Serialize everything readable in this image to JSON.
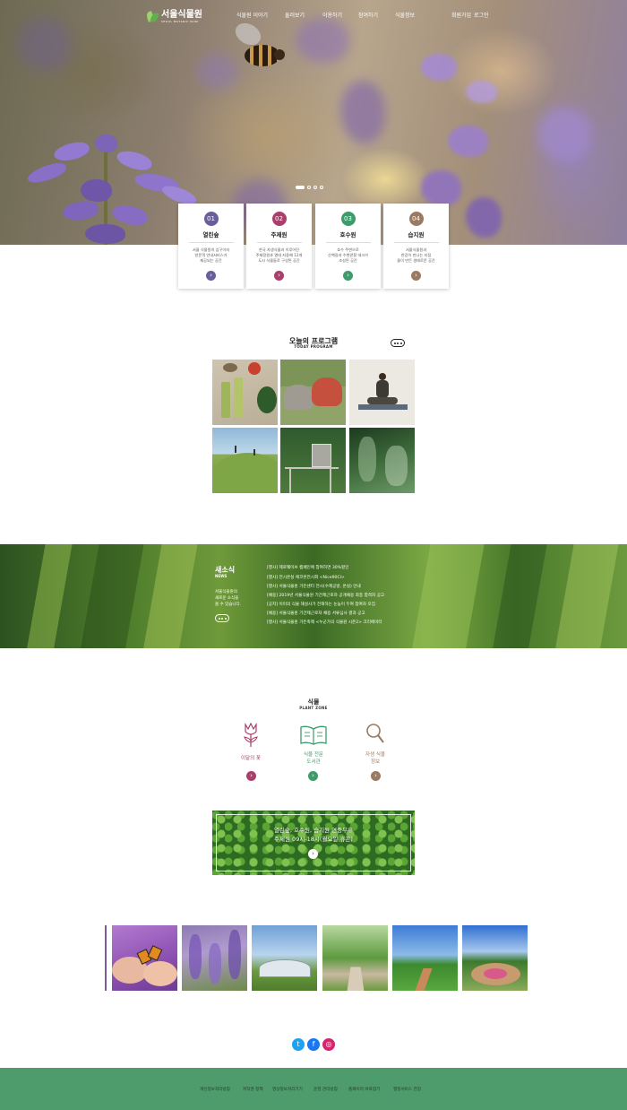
{
  "brand": {
    "name": "서울식물원",
    "sub": "SEOUL BOTANIC PARK"
  },
  "nav": {
    "items": [
      "식물원 이야기",
      "둘러보기",
      "이용하기",
      "참여하기",
      "식물정보"
    ]
  },
  "util": {
    "join": "회원가입",
    "login": "로그인"
  },
  "gardens": [
    {
      "num": "01",
      "title": "열린숲",
      "desc": "서울 식물원의 입구이자\n방문객 안내서비스가\n제공되는 공간",
      "color": "#6b5f9a"
    },
    {
      "num": "02",
      "title": "주제원",
      "desc": "한국 자생식물과 이루어진\n주제정원과 열대 지중해 12개\n도시 식물들로 구성된 공간",
      "color": "#a9406c"
    },
    {
      "num": "03",
      "title": "호수원",
      "desc": "호수 주변으로\n산책길과 수변관찰 데크가\n조성된 공간",
      "color": "#3f9a6c"
    },
    {
      "num": "04",
      "title": "습지원",
      "desc": "서울식물원과\n한강이 만나는 지점\n물이 만든 생태로운 공간",
      "color": "#9a7a62"
    }
  ],
  "program": {
    "title": "오늘의 프로그램",
    "sub": "TODAY PROGRAM"
  },
  "news": {
    "title": "새소식",
    "sub": "NEWS",
    "desc": "서울식물원의\n새로운 소식을\n볼 수 있습니다.",
    "items": [
      "[행사] 제로웨이브 캠페인에 참여하면 30%할인",
      "[행사] 전시온실 에코혼전시회 <Nice90Cl>",
      "[행사] 서울식물원 가든센터 전시(수제공방, 온실) 안내",
      "[채용] 2019년 서울식물원 기간제근로자 공개채용 최종 합격자 공고",
      "[공지] 이미의 식물 해설사가 전해하는 눈높이 두여 참여자 모집",
      "[채용] 서울식물원 기간제근로자 채용 서류심사 결과 공고",
      "[행사] 서울식물원 가든축제 <누군가의 식물원 시즌2> 크리에이터"
    ]
  },
  "plant_zone": {
    "title": "식물",
    "sub": "PLANT ZONE",
    "items": [
      {
        "label": "이달의 꽃",
        "color": "#a9406c",
        "icon": "tulip-icon"
      },
      {
        "label": "식물 전문\n도서관",
        "color": "#3f9a6c",
        "icon": "book-icon"
      },
      {
        "label": "자생 식물\n정보",
        "color": "#9a7a62",
        "icon": "magnifier-icon"
      }
    ]
  },
  "banner": {
    "text": "열린숲, 호수원, 습지원 연중무휴\n주제원 09시-18시(월요일 휴관)"
  },
  "sns": [
    {
      "name": "twitter",
      "glyph": "t",
      "color": "#1da1f2"
    },
    {
      "name": "facebook",
      "glyph": "f",
      "color": "#1877f2"
    },
    {
      "name": "instagram",
      "glyph": "◎",
      "color": "#d6246e"
    }
  ],
  "footer": {
    "links": [
      "개인정보처리방침",
      "저작권 정책",
      "영상정보처리기기",
      "운영 관리방침",
      "홈페이지 바로잡기",
      "행정서비스 헌장"
    ]
  }
}
